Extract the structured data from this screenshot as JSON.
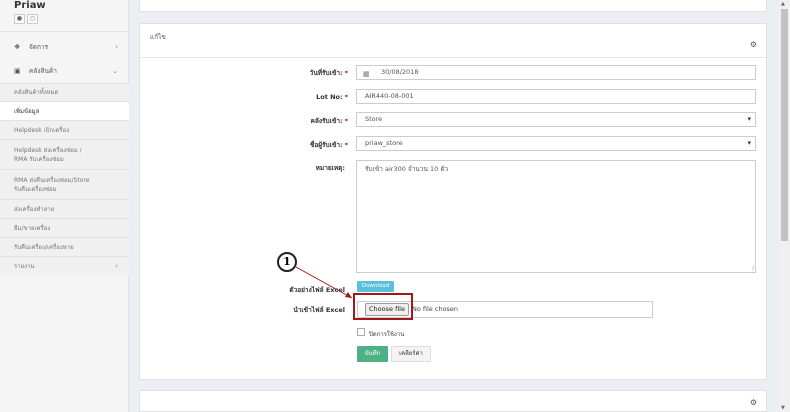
{
  "brand": {
    "name": "Priaw",
    "icons": [
      "user-icon",
      "power-icon"
    ]
  },
  "nav": {
    "top_items": [
      {
        "label": "จัดการ",
        "icon": "cube-icon"
      },
      {
        "label": "คลังสินค้า",
        "icon": "box-icon"
      }
    ],
    "sub_items": [
      {
        "label": "คลังสินค้าทั้งหมด"
      },
      {
        "label": "เพิ่มข้อมูล"
      },
      {
        "label": "Helpdesk เบิกเครื่อง"
      },
      {
        "label_line1": "Helpdesk ส่งเครื่องซ่อม /",
        "label_line2": "RMA รับเครื่องซ่อม"
      },
      {
        "label_line1": "RMA ส่งคืนเครื่องซ่อม/Store",
        "label_line2": "รับคืนเครื่องซ่อม"
      },
      {
        "label": "ส่งเครื่องทำลาย"
      },
      {
        "label": "ยืม/ขายเครื่อง"
      },
      {
        "label": "รับคืนเครื่อง/เครื่องหาย"
      },
      {
        "label": "รายงาน"
      }
    ]
  },
  "form": {
    "title": "แก้ไข",
    "date_label": "วันที่รับเข้า:",
    "date_value": "30/08/2018",
    "lot_label": "Lot No:",
    "lot_value": "AIR440-08-001",
    "warehouse_label": "คลังรับเข้า:",
    "warehouse_value": "Store",
    "receiver_label": "ชื่อผู้รับเข้า:",
    "receiver_value": "priaw_store",
    "note_label": "หมายเหตุ:",
    "note_value": "รับเข้า air300 จำนวน 10 ตัว",
    "excel_sample_label": "ตัวอย่างไฟล์ Excel",
    "download_label": "Download",
    "import_label": "นำเข้าไฟล์ Excel",
    "choose_file_label": "Choose file",
    "no_file_text": "No file chosen",
    "disable_label": "ปิดการใช้งาน",
    "save_label": "บันทึก",
    "clear_label": "เคลียร์ค่า",
    "callout_number": "1"
  }
}
